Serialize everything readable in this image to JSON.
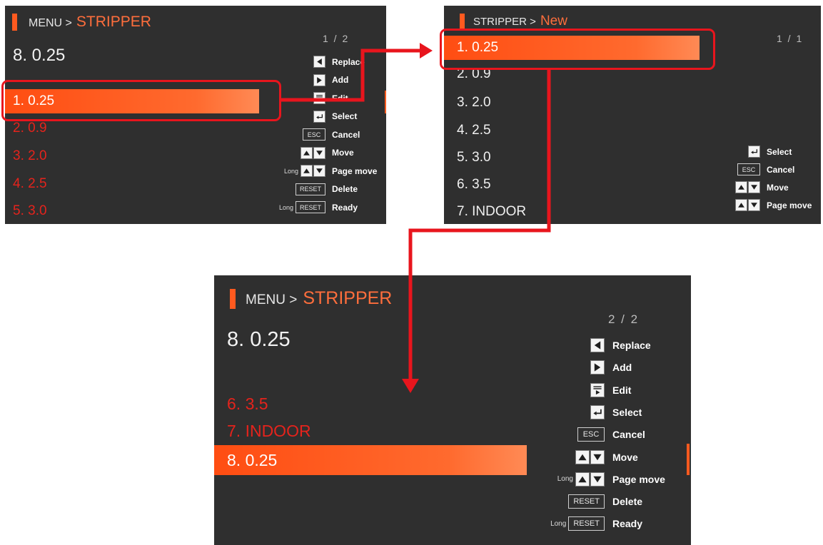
{
  "screen1": {
    "breadcrumb": {
      "prefix": "MENU >",
      "current": "STRIPPER"
    },
    "page": "1 / 2",
    "selected": "8. 0.25",
    "rows": [
      "1. 0.25",
      "2. 0.9",
      "3. 2.0",
      "4. 2.5",
      "5. 3.0"
    ],
    "legend": [
      {
        "keys": [
          "left"
        ],
        "label": "Replace"
      },
      {
        "keys": [
          "right"
        ],
        "label": "Add"
      },
      {
        "keys": [
          "edit"
        ],
        "label": "Edit"
      },
      {
        "keys": [
          "enter"
        ],
        "label": "Select"
      },
      {
        "keys": [
          "ESC"
        ],
        "label": "Cancel"
      },
      {
        "keys": [
          "up",
          "down"
        ],
        "label": "Move"
      },
      {
        "prefix": "Long",
        "keys": [
          "up",
          "down"
        ],
        "label": "Page move"
      },
      {
        "keys": [
          "RESET"
        ],
        "label": "Delete"
      },
      {
        "prefix": "Long",
        "keys": [
          "RESET"
        ],
        "label": "Ready"
      }
    ]
  },
  "screen2": {
    "breadcrumb": {
      "prefix": "STRIPPER >",
      "current": "New"
    },
    "page": "1 / 1",
    "rows": [
      "1. 0.25",
      "2. 0.9",
      "3. 2.0",
      "4. 2.5",
      "5. 3.0",
      "6. 3.5",
      "7. INDOOR"
    ],
    "legend": [
      {
        "keys": [
          "enter"
        ],
        "label": "Select"
      },
      {
        "keys": [
          "ESC"
        ],
        "label": "Cancel"
      },
      {
        "keys": [
          "up",
          "down"
        ],
        "label": "Move"
      },
      {
        "keys": [
          "up",
          "down"
        ],
        "label": "Page move"
      }
    ]
  },
  "screen3": {
    "breadcrumb": {
      "prefix": "MENU >",
      "current": "STRIPPER"
    },
    "page": "2 / 2",
    "selected": "8. 0.25",
    "rows": [
      "6. 3.5",
      "7. INDOOR",
      "8. 0.25"
    ],
    "legend": [
      {
        "keys": [
          "left"
        ],
        "label": "Replace"
      },
      {
        "keys": [
          "right"
        ],
        "label": "Add"
      },
      {
        "keys": [
          "edit"
        ],
        "label": "Edit"
      },
      {
        "keys": [
          "enter"
        ],
        "label": "Select"
      },
      {
        "keys": [
          "ESC"
        ],
        "label": "Cancel"
      },
      {
        "keys": [
          "up",
          "down"
        ],
        "label": "Move"
      },
      {
        "prefix": "Long",
        "keys": [
          "up",
          "down"
        ],
        "label": "Page move"
      },
      {
        "keys": [
          "RESET"
        ],
        "label": "Delete"
      },
      {
        "prefix": "Long",
        "keys": [
          "RESET"
        ],
        "label": "Ready"
      }
    ]
  },
  "colors": {
    "screen_bg": "#2f2f2f",
    "accent": "#ff5a1f",
    "inactive_row": "#e5231c",
    "callout": "#e8151d"
  }
}
